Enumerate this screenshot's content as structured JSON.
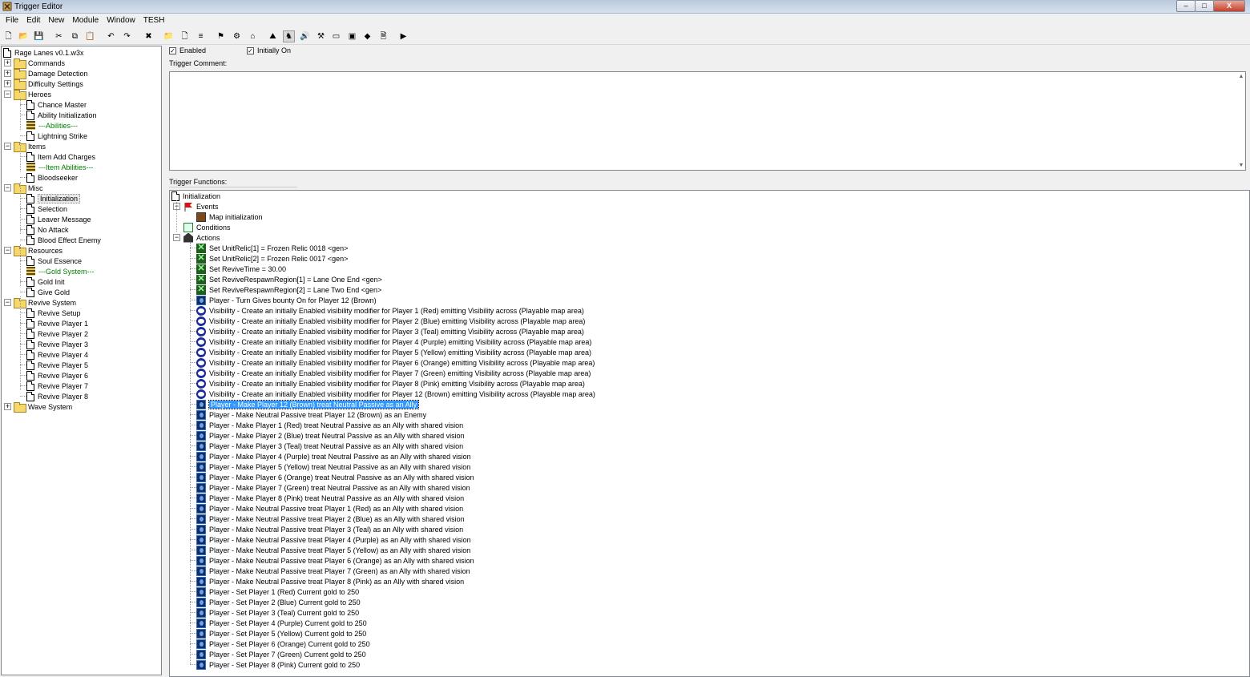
{
  "window": {
    "title": "Trigger Editor",
    "minimize": "–",
    "maximize": "□",
    "close": "X"
  },
  "menu": [
    "File",
    "Edit",
    "New",
    "Module",
    "Window",
    "TESH"
  ],
  "toolbar": [
    {
      "icon": "new-icon",
      "g": "🗋"
    },
    {
      "icon": "open-icon",
      "g": "📂"
    },
    {
      "icon": "save-icon",
      "g": "💾"
    },
    {
      "icon": "cut-icon",
      "g": "✂"
    },
    {
      "icon": "copy-icon",
      "g": "⧉"
    },
    {
      "icon": "paste-icon",
      "g": "📋"
    },
    {
      "icon": "undo-icon",
      "g": "↶"
    },
    {
      "icon": "redo-icon",
      "g": "↷"
    },
    {
      "icon": "trigger-editor-icon",
      "g": "✖"
    },
    {
      "icon": "new-category-icon",
      "g": "📁"
    },
    {
      "icon": "new-trigger-icon",
      "g": "🗋"
    },
    {
      "icon": "new-comment-icon",
      "g": "≡"
    },
    {
      "icon": "new-event-icon",
      "g": "⚑"
    },
    {
      "icon": "new-condition-icon",
      "g": "⚙"
    },
    {
      "icon": "new-action-icon",
      "g": "⌂"
    },
    {
      "icon": "terrain-editor-icon",
      "g": "⛰"
    },
    {
      "icon": "unit-editor-icon",
      "g": "♞"
    },
    {
      "icon": "sound-editor-icon",
      "g": "🔊"
    },
    {
      "icon": "object-editor-icon",
      "g": "⚒"
    },
    {
      "icon": "campaign-editor-icon",
      "g": "▭"
    },
    {
      "icon": "ai-editor-icon",
      "g": "▣"
    },
    {
      "icon": "object-manager-icon",
      "g": "◆"
    },
    {
      "icon": "import-manager-icon",
      "g": "🗎"
    },
    {
      "icon": "test-map-icon",
      "g": "▶"
    }
  ],
  "tree": {
    "root": "Rage Lanes v0.1.w3x",
    "items": [
      {
        "label": "Commands",
        "type": "folder",
        "level": 0,
        "exp": "+"
      },
      {
        "label": "Damage Detection",
        "type": "folder",
        "level": 0,
        "exp": "+"
      },
      {
        "label": "Difficulty Settings",
        "type": "folder",
        "level": 0,
        "exp": "+"
      },
      {
        "label": "Heroes",
        "type": "folder",
        "level": 0,
        "exp": "-"
      },
      {
        "label": "Chance Master",
        "type": "doc",
        "level": 1
      },
      {
        "label": "Ability Initialization",
        "type": "doc",
        "level": 1
      },
      {
        "label": "---Abilities---",
        "type": "comment",
        "level": 1
      },
      {
        "label": "Lightning Strike",
        "type": "doc",
        "level": 1
      },
      {
        "label": "Items",
        "type": "folder",
        "level": 0,
        "exp": "-"
      },
      {
        "label": "Item Add Charges",
        "type": "doc",
        "level": 1
      },
      {
        "label": "---Item Abilities---",
        "type": "comment",
        "level": 1
      },
      {
        "label": "Bloodseeker",
        "type": "doc",
        "level": 1
      },
      {
        "label": "Misc",
        "type": "folder",
        "level": 0,
        "exp": "-"
      },
      {
        "label": "Initialization",
        "type": "doc",
        "level": 1,
        "selected": true
      },
      {
        "label": "Selection",
        "type": "doc",
        "level": 1
      },
      {
        "label": "Leaver Message",
        "type": "doc",
        "level": 1
      },
      {
        "label": "No Attack",
        "type": "doc",
        "level": 1
      },
      {
        "label": "Blood Effect Enemy",
        "type": "doc",
        "level": 1
      },
      {
        "label": "Resources",
        "type": "folder",
        "level": 0,
        "exp": "-"
      },
      {
        "label": "Soul Essence",
        "type": "doc",
        "level": 1
      },
      {
        "label": "---Gold System---",
        "type": "comment",
        "level": 1
      },
      {
        "label": "Gold Init",
        "type": "doc",
        "level": 1
      },
      {
        "label": "Give Gold",
        "type": "doc",
        "level": 1
      },
      {
        "label": "Revive System",
        "type": "folder",
        "level": 0,
        "exp": "-"
      },
      {
        "label": "Revive Setup",
        "type": "doc",
        "level": 1
      },
      {
        "label": "Revive Player 1",
        "type": "doc",
        "level": 1
      },
      {
        "label": "Revive Player 2",
        "type": "doc",
        "level": 1
      },
      {
        "label": "Revive Player 3",
        "type": "doc",
        "level": 1
      },
      {
        "label": "Revive Player 4",
        "type": "doc",
        "level": 1
      },
      {
        "label": "Revive Player 5",
        "type": "doc",
        "level": 1
      },
      {
        "label": "Revive Player 6",
        "type": "doc",
        "level": 1
      },
      {
        "label": "Revive Player 7",
        "type": "doc",
        "level": 1
      },
      {
        "label": "Revive Player 8",
        "type": "doc",
        "level": 1
      },
      {
        "label": "Wave System",
        "type": "folder",
        "level": 0,
        "exp": "+"
      }
    ]
  },
  "options": {
    "enabled": "Enabled",
    "initially_on": "Initially On",
    "enabled_checked": true,
    "initially_on_checked": true,
    "check": "✓"
  },
  "trigger_comment_label": "Trigger Comment:",
  "trigger_functions_label": "Trigger Functions:",
  "functions": {
    "root": "Initialization",
    "events_label": "Events",
    "event_items": [
      "Map initialization"
    ],
    "conditions_label": "Conditions",
    "actions_label": "Actions",
    "actions": [
      {
        "text": "Set UnitRelic[1] = Frozen Relic 0018 <gen>",
        "icon": "set"
      },
      {
        "text": "Set UnitRelic[2] = Frozen Relic 0017 <gen>",
        "icon": "set"
      },
      {
        "text": "Set ReviveTime = 30.00",
        "icon": "set"
      },
      {
        "text": "Set ReviveRespawnRegion[1] = Lane One End <gen>",
        "icon": "set"
      },
      {
        "text": "Set ReviveRespawnRegion[2] = Lane Two End <gen>",
        "icon": "set"
      },
      {
        "text": "Player - Turn Gives bounty On for Player 12 (Brown)",
        "icon": "player"
      },
      {
        "text": "Visibility - Create an initially Enabled visibility modifier for Player 1 (Red) emitting Visibility across (Playable map area)",
        "icon": "vis"
      },
      {
        "text": "Visibility - Create an initially Enabled visibility modifier for Player 2 (Blue) emitting Visibility across (Playable map area)",
        "icon": "vis"
      },
      {
        "text": "Visibility - Create an initially Enabled visibility modifier for Player 3 (Teal) emitting Visibility across (Playable map area)",
        "icon": "vis"
      },
      {
        "text": "Visibility - Create an initially Enabled visibility modifier for Player 4 (Purple) emitting Visibility across (Playable map area)",
        "icon": "vis"
      },
      {
        "text": "Visibility - Create an initially Enabled visibility modifier for Player 5 (Yellow) emitting Visibility across (Playable map area)",
        "icon": "vis"
      },
      {
        "text": "Visibility - Create an initially Enabled visibility modifier for Player 6 (Orange) emitting Visibility across (Playable map area)",
        "icon": "vis"
      },
      {
        "text": "Visibility - Create an initially Enabled visibility modifier for Player 7 (Green) emitting Visibility across (Playable map area)",
        "icon": "vis"
      },
      {
        "text": "Visibility - Create an initially Enabled visibility modifier for Player 8 (Pink) emitting Visibility across (Playable map area)",
        "icon": "vis"
      },
      {
        "text": "Visibility - Create an initially Enabled visibility modifier for Player 12 (Brown) emitting Visibility across (Playable map area)",
        "icon": "vis"
      },
      {
        "text": "Player - Make Player 12 (Brown) treat Neutral Passive as an Ally",
        "icon": "player",
        "selected": true
      },
      {
        "text": "Player - Make Neutral Passive treat Player 12 (Brown) as an Enemy",
        "icon": "player"
      },
      {
        "text": "Player - Make Player 1 (Red) treat Neutral Passive as an Ally with shared vision",
        "icon": "player"
      },
      {
        "text": "Player - Make Player 2 (Blue) treat Neutral Passive as an Ally with shared vision",
        "icon": "player"
      },
      {
        "text": "Player - Make Player 3 (Teal) treat Neutral Passive as an Ally with shared vision",
        "icon": "player"
      },
      {
        "text": "Player - Make Player 4 (Purple) treat Neutral Passive as an Ally with shared vision",
        "icon": "player"
      },
      {
        "text": "Player - Make Player 5 (Yellow) treat Neutral Passive as an Ally with shared vision",
        "icon": "player"
      },
      {
        "text": "Player - Make Player 6 (Orange) treat Neutral Passive as an Ally with shared vision",
        "icon": "player"
      },
      {
        "text": "Player - Make Player 7 (Green) treat Neutral Passive as an Ally with shared vision",
        "icon": "player"
      },
      {
        "text": "Player - Make Player 8 (Pink) treat Neutral Passive as an Ally with shared vision",
        "icon": "player"
      },
      {
        "text": "Player - Make Neutral Passive treat Player 1 (Red) as an Ally with shared vision",
        "icon": "player"
      },
      {
        "text": "Player - Make Neutral Passive treat Player 2 (Blue) as an Ally with shared vision",
        "icon": "player"
      },
      {
        "text": "Player - Make Neutral Passive treat Player 3 (Teal) as an Ally with shared vision",
        "icon": "player"
      },
      {
        "text": "Player - Make Neutral Passive treat Player 4 (Purple) as an Ally with shared vision",
        "icon": "player"
      },
      {
        "text": "Player - Make Neutral Passive treat Player 5 (Yellow) as an Ally with shared vision",
        "icon": "player"
      },
      {
        "text": "Player - Make Neutral Passive treat Player 6 (Orange) as an Ally with shared vision",
        "icon": "player"
      },
      {
        "text": "Player - Make Neutral Passive treat Player 7 (Green) as an Ally with shared vision",
        "icon": "player"
      },
      {
        "text": "Player - Make Neutral Passive treat Player 8 (Pink) as an Ally with shared vision",
        "icon": "player"
      },
      {
        "text": "Player - Set Player 1 (Red) Current gold to 250",
        "icon": "player"
      },
      {
        "text": "Player - Set Player 2 (Blue) Current gold to 250",
        "icon": "player"
      },
      {
        "text": "Player - Set Player 3 (Teal) Current gold to 250",
        "icon": "player"
      },
      {
        "text": "Player - Set Player 4 (Purple) Current gold to 250",
        "icon": "player"
      },
      {
        "text": "Player - Set Player 5 (Yellow) Current gold to 250",
        "icon": "player"
      },
      {
        "text": "Player - Set Player 6 (Orange) Current gold to 250",
        "icon": "player"
      },
      {
        "text": "Player - Set Player 7 (Green) Current gold to 250",
        "icon": "player"
      },
      {
        "text": "Player - Set Player 8 (Pink) Current gold to 250",
        "icon": "player"
      }
    ]
  },
  "colors": {
    "comment_text": "#008000",
    "selection": "#3399ff",
    "folder": "#f6d86a"
  }
}
